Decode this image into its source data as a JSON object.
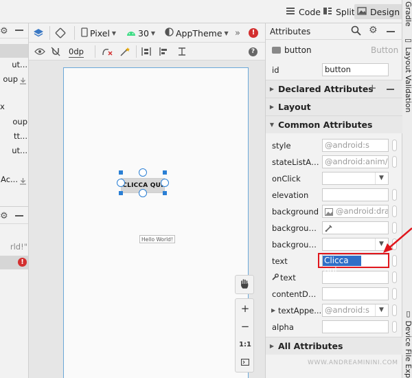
{
  "view_modes": [
    {
      "label": "Code",
      "icon": "lines-icon"
    },
    {
      "label": "Split",
      "icon": "split-icon"
    },
    {
      "label": "Design",
      "icon": "image-icon"
    }
  ],
  "right_strip": {
    "gradle": "Gradle",
    "layout_validation": "Layout Validation",
    "device_file": "Device File Explo"
  },
  "left_panel": {
    "items": [
      "ut...",
      "oup",
      "x",
      "oup",
      "tt...",
      "ut...",
      "Ac...",
      "rld!\""
    ]
  },
  "design_toolbar": {
    "device": "Pixel",
    "api": "30",
    "theme": "AppTheme",
    "margin": "0dp"
  },
  "canvas": {
    "button_text": "CLICCA QUI",
    "hello_text": "Hello World!",
    "zoom_reset": "1:1"
  },
  "attributes": {
    "header": "Attributes",
    "component": "button",
    "component_type": "Button",
    "id_label": "id",
    "id_value": "button",
    "sections": {
      "declared": "Declared Attributes",
      "layout": "Layout",
      "common": "Common Attributes",
      "all": "All Attributes"
    },
    "rows": [
      {
        "label": "style",
        "value": "@android:s"
      },
      {
        "label": "stateListAni...",
        "value": "@android:anim/"
      },
      {
        "label": "onClick",
        "value": ""
      },
      {
        "label": "elevation",
        "value": ""
      },
      {
        "label": "background",
        "value": "@android:dra"
      },
      {
        "label": "backgroun...",
        "value": ""
      },
      {
        "label": "backgroun...",
        "value": ""
      },
      {
        "label": "text",
        "value": "Clicca qui"
      },
      {
        "label": "text",
        "value": ""
      },
      {
        "label": "contentDes...",
        "value": ""
      },
      {
        "label": "textAppe...",
        "value": "@android:s"
      },
      {
        "label": "alpha",
        "value": ""
      }
    ]
  },
  "watermark": "WWW.ANDREAMININI.COM",
  "colors": {
    "accent_blue": "#2a7fd4",
    "annotation_red": "#e0161c",
    "error_red": "#d32f2f",
    "android_green": "#3ddc84"
  }
}
